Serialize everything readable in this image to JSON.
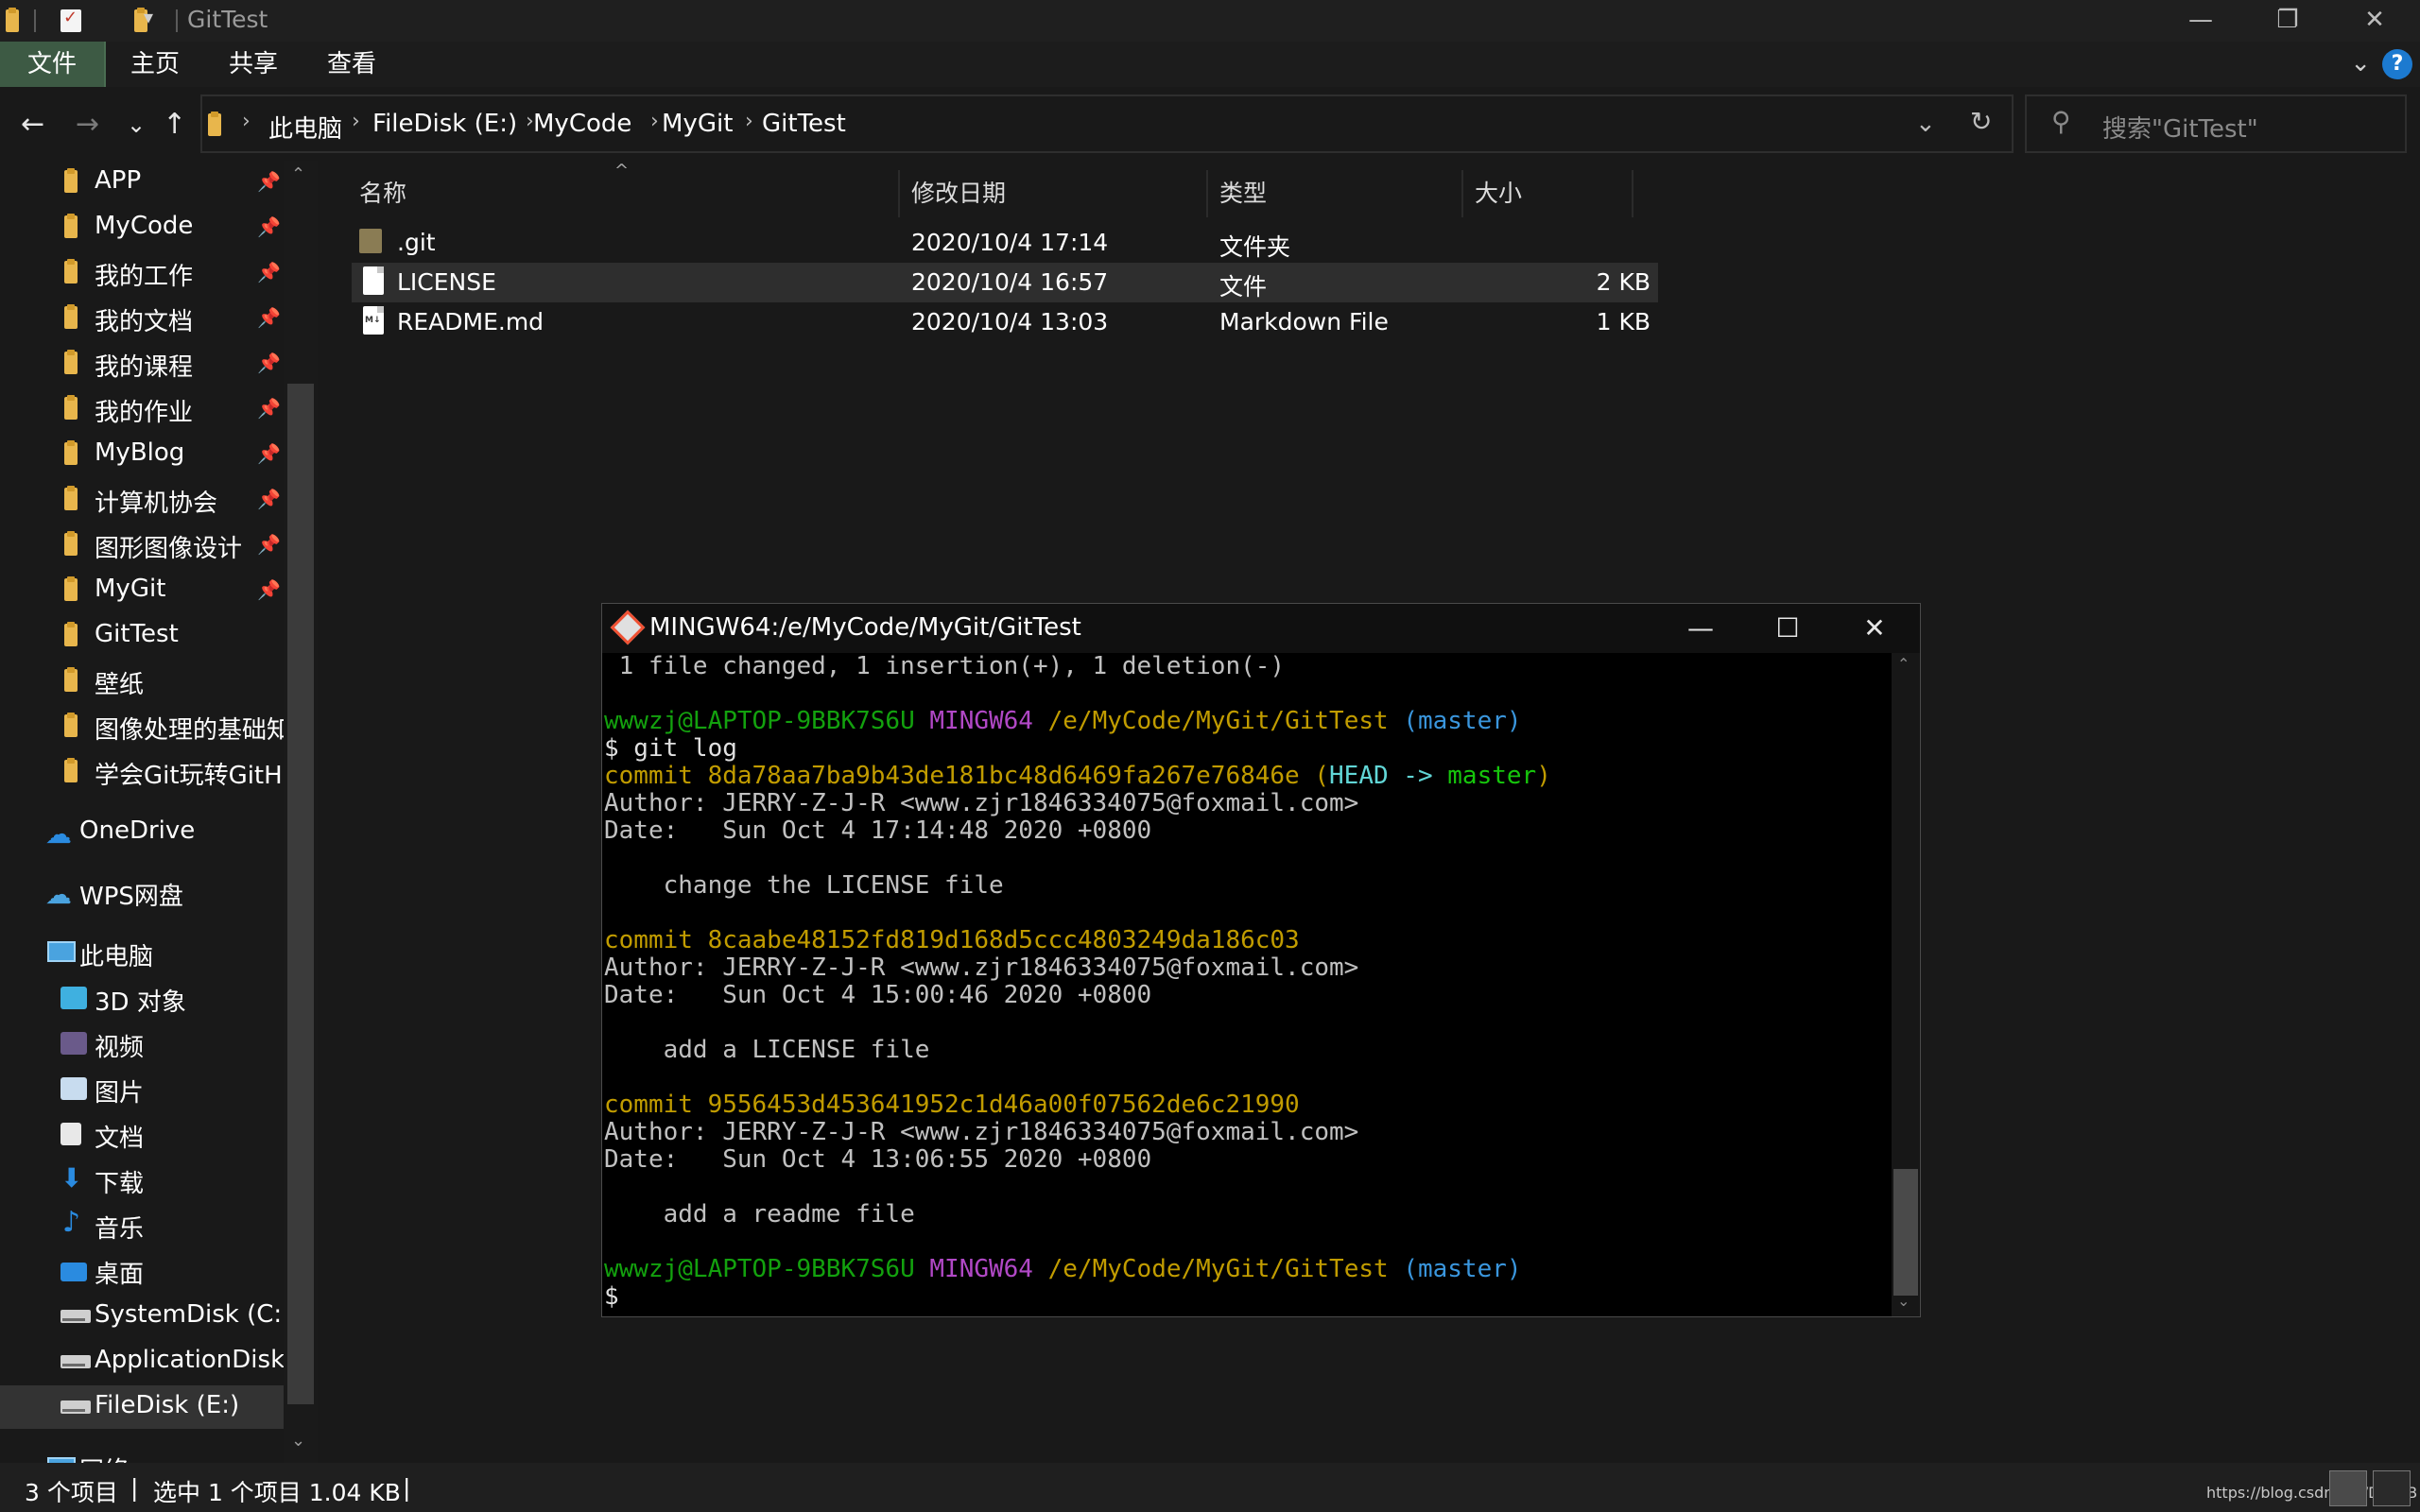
{
  "titlebar": {
    "title": "GitTest",
    "minimize": "—",
    "restore": "❐",
    "close": "✕",
    "dropdown": "▾"
  },
  "ribbon": {
    "tabs": [
      "文件",
      "主页",
      "共享",
      "查看"
    ],
    "collapse": "⌄",
    "help": "?"
  },
  "address": {
    "back": "←",
    "forward": "→",
    "recent": "⌄",
    "up": "↑",
    "crumbs": [
      "此电脑",
      "FileDisk (E:)",
      "MyCode",
      "MyGit",
      "GitTest"
    ],
    "separator": "›",
    "dropdown": "⌄",
    "refresh": "↻"
  },
  "search": {
    "placeholder": "搜索\"GitTest\"",
    "icon": "⚲"
  },
  "nav": {
    "quick_access": [
      {
        "label": "APP",
        "pinned": true
      },
      {
        "label": "MyCode",
        "pinned": true
      },
      {
        "label": "我的工作",
        "pinned": true
      },
      {
        "label": "我的文档",
        "pinned": true
      },
      {
        "label": "我的课程",
        "pinned": true
      },
      {
        "label": "我的作业",
        "pinned": true
      },
      {
        "label": "MyBlog",
        "pinned": true
      },
      {
        "label": "计算机协会",
        "pinned": true
      },
      {
        "label": "图形图像设计",
        "pinned": true
      },
      {
        "label": "MyGit",
        "pinned": true
      },
      {
        "label": "GitTest",
        "pinned": false
      },
      {
        "label": "壁纸",
        "pinned": false
      },
      {
        "label": "图像处理的基础知识",
        "pinned": false
      },
      {
        "label": "学会Git玩转GitHub",
        "pinned": false
      }
    ],
    "pin_glyph": "📌",
    "onedrive": "OneDrive",
    "wps": "WPS网盘",
    "this_pc": "此电脑",
    "pc_items": [
      "3D 对象",
      "视频",
      "图片",
      "文档",
      "下载",
      "音乐",
      "桌面"
    ],
    "drives": [
      "SystemDisk (C:)",
      "ApplicationDisk (D:)",
      "FileDisk (E:)"
    ],
    "network": "网络",
    "scroll_up": "⌃",
    "scroll_down": "⌄"
  },
  "filelist": {
    "sort_glyph": "^",
    "columns": [
      "名称",
      "修改日期",
      "类型",
      "大小"
    ],
    "rows": [
      {
        "name": ".git",
        "date": "2020/10/4 17:14",
        "type": "文件夹",
        "size": ""
      },
      {
        "name": "LICENSE",
        "date": "2020/10/4 16:57",
        "type": "文件",
        "size": "2 KB"
      },
      {
        "name": "README.md",
        "date": "2020/10/4 13:03",
        "type": "Markdown File",
        "size": "1 KB"
      }
    ]
  },
  "status": {
    "count": "3 个项目",
    "selected": "选中 1 个项目  1.04 KB",
    "sep": "|",
    "watermark": "https://blog.csdn.net/D_si_B"
  },
  "terminal": {
    "title": "MINGW64:/e/MyCode/MyGit/GitTest",
    "min": "—",
    "max": "☐",
    "close": "✕",
    "line_changed": " 1 file changed, 1 insertion(+), 1 deletion(-)",
    "prompt_user": "wwwzj@LAPTOP-9BBK7S6U",
    "prompt_env": "MINGW64",
    "prompt_path": "/e/MyCode/MyGit/GitTest",
    "prompt_branch": "(master)",
    "cmd": "$ git log",
    "commits": [
      {
        "hash": "commit 8da78aa7ba9b43de181bc48d6469fa267e76846e",
        "head_open": "(",
        "head_ref": "HEAD -> ",
        "head_branch": "master",
        "head_close": ")",
        "author": "Author: JERRY-Z-J-R <www.zjr1846334075@foxmail.com>",
        "date": "Date:   Sun Oct 4 17:14:48 2020 +0800",
        "message": "    change the LICENSE file"
      },
      {
        "hash": "commit 8caabe48152fd819d168d5ccc4803249da186c03",
        "author": "Author: JERRY-Z-J-R <www.zjr1846334075@foxmail.com>",
        "date": "Date:   Sun Oct 4 15:00:46 2020 +0800",
        "message": "    add a LICENSE file"
      },
      {
        "hash": "commit 9556453d453641952c1d46a00f07562de6c21990",
        "author": "Author: JERRY-Z-J-R <www.zjr1846334075@foxmail.com>",
        "date": "Date:   Sun Oct 4 13:06:55 2020 +0800",
        "message": "    add a readme file"
      }
    ],
    "final_prompt": "$"
  },
  "colors": {
    "accent_file_tab": "#3d5a44",
    "prompt_user": "#13a10e",
    "prompt_env": "#b148c6",
    "prompt_path": "#c19c00",
    "prompt_branch": "#3a96dd",
    "commit_hash": "#c19c00",
    "head_ref": "#61d6d6",
    "head_branch": "#16c60c"
  }
}
